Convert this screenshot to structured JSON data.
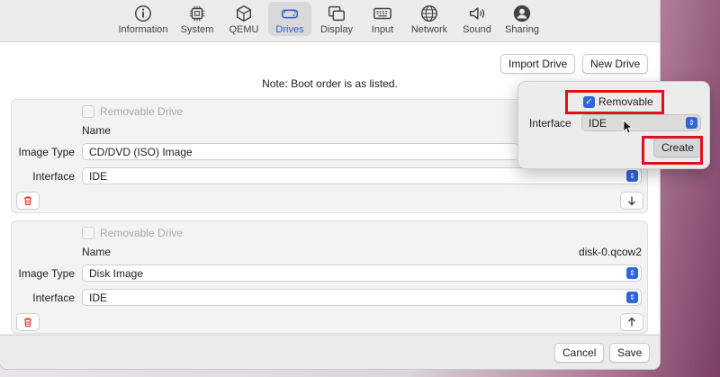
{
  "toolbar": {
    "tabs": [
      {
        "label": "Information",
        "icon": "info-icon"
      },
      {
        "label": "System",
        "icon": "chip-icon"
      },
      {
        "label": "QEMU",
        "icon": "cube-icon"
      },
      {
        "label": "Drives",
        "icon": "drive-icon",
        "active": true
      },
      {
        "label": "Display",
        "icon": "display-icon"
      },
      {
        "label": "Input",
        "icon": "keyboard-icon"
      },
      {
        "label": "Network",
        "icon": "globe-icon"
      },
      {
        "label": "Sound",
        "icon": "speaker-icon"
      },
      {
        "label": "Sharing",
        "icon": "person-icon"
      }
    ]
  },
  "actions": {
    "import_drive": "Import Drive",
    "new_drive": "New Drive"
  },
  "note": "Note: Boot order is as listed.",
  "drives": [
    {
      "removable_label": "Removable Drive",
      "name_label": "Name",
      "name_value": "",
      "image_type_label": "Image Type",
      "image_type_value": "CD/DVD (ISO) Image",
      "interface_label": "Interface",
      "interface_value": "IDE",
      "move_icon": "arrow-down-icon"
    },
    {
      "removable_label": "Removable Drive",
      "name_label": "Name",
      "name_value": "disk-0.qcow2",
      "image_type_label": "Image Type",
      "image_type_value": "Disk Image",
      "interface_label": "Interface",
      "interface_value": "IDE",
      "move_icon": "arrow-up-icon"
    }
  ],
  "popover": {
    "removable_label": "Removable",
    "removable_checked": true,
    "interface_label": "Interface",
    "interface_value": "IDE",
    "create_label": "Create"
  },
  "footer": {
    "cancel": "Cancel",
    "save": "Save"
  },
  "colors": {
    "accent": "#2f66d8",
    "highlight": "#e0101e",
    "delete": "#e0443e"
  }
}
